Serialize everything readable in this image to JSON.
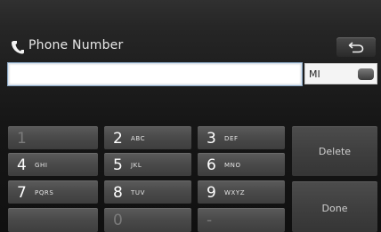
{
  "header": {
    "title": "Phone Number",
    "icon": "phone-handset-icon",
    "back_icon": "back-arrow-icon"
  },
  "number_input": {
    "value": ""
  },
  "number_type": {
    "selected": "MI",
    "toggle_icon": "toggle-button-icon"
  },
  "keypad": {
    "keys": [
      {
        "digit": "1",
        "letters": ""
      },
      {
        "digit": "2",
        "letters": "ABC"
      },
      {
        "digit": "3",
        "letters": "DEF"
      },
      {
        "digit": "4",
        "letters": "GHI"
      },
      {
        "digit": "5",
        "letters": "JKL"
      },
      {
        "digit": "6",
        "letters": "MNO"
      },
      {
        "digit": "7",
        "letters": "PQRS"
      },
      {
        "digit": "8",
        "letters": "TUV"
      },
      {
        "digit": "9",
        "letters": "WXYZ"
      },
      {
        "digit": "",
        "letters": ""
      },
      {
        "digit": "0",
        "letters": ""
      },
      {
        "digit": "-",
        "letters": ""
      }
    ],
    "delete_label": "Delete",
    "done_label": "Done"
  },
  "colors": {
    "background_top": "#303030",
    "background_bottom": "#101010",
    "input_focus_border": "#8ca8c4",
    "key_face": "#4a4a4a",
    "text": "#ffffff"
  }
}
